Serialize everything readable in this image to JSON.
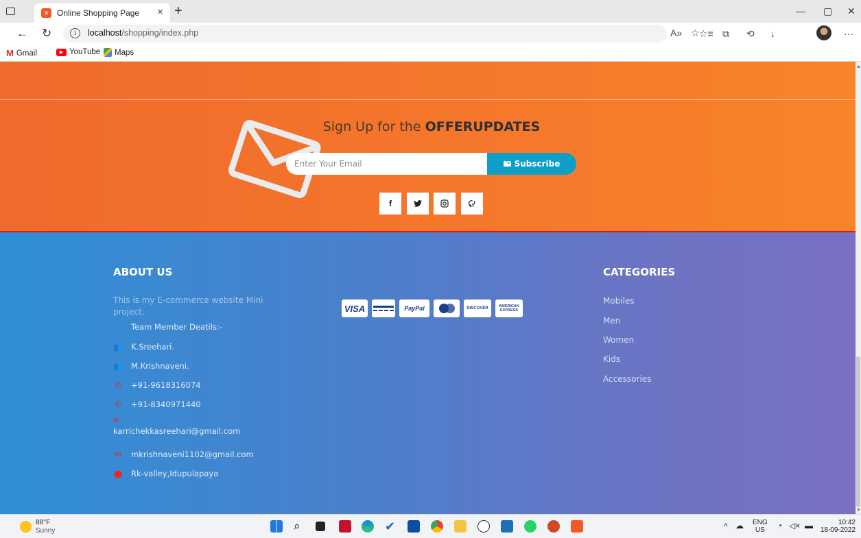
{
  "browser": {
    "tab_title": "Online Shopping Page",
    "url_host": "localhost",
    "url_path": "/shopping/index.php",
    "bookmarks": [
      {
        "label": "Gmail",
        "icon": "gmail-icon"
      },
      {
        "label": "YouTube",
        "icon": "youtube-icon"
      },
      {
        "label": "Maps",
        "icon": "maps-icon"
      }
    ]
  },
  "newsletter": {
    "title_prefix": "Sign Up for the ",
    "title_bold": "OFFERUPDATES",
    "email_placeholder": "Enter Your Email",
    "subscribe_label": "Subscribe",
    "social": [
      {
        "name": "facebook-icon",
        "glyph": "f"
      },
      {
        "name": "twitter-icon",
        "glyph": "🐦"
      },
      {
        "name": "instagram-icon",
        "glyph": "◎"
      },
      {
        "name": "github-icon",
        "glyph": "○"
      }
    ]
  },
  "footer": {
    "about": {
      "title": "ABOUT US",
      "description": "This is my E-commerce website Mini project.",
      "team_heading": "Team Member Deatils:-",
      "members": [
        "K.Sreehari.",
        "M.Krishnaveni."
      ],
      "phones": [
        "+91-9618316074",
        "+91-8340971440"
      ],
      "emails": [
        "karrichekkasreehari@gmail.com",
        "mkrishnaveni1102@gmail.com"
      ],
      "address": "Rk-valley,Idupulapaya"
    },
    "payment_cards": [
      {
        "name": "visa-card-icon",
        "label": "VISA"
      },
      {
        "name": "credit-card-icon",
        "label": ""
      },
      {
        "name": "paypal-card-icon",
        "label": "PayPal"
      },
      {
        "name": "mastercard-card-icon",
        "label": ""
      },
      {
        "name": "discover-card-icon",
        "label": "DISCOVER"
      },
      {
        "name": "amex-card-icon",
        "label": "AMERICAN EXPRESS"
      }
    ],
    "categories": {
      "title": "CATEGORIES",
      "items": [
        "Mobiles",
        "Men",
        "Women",
        "Kids",
        "Accessories"
      ]
    }
  },
  "taskbar": {
    "weather_temp": "88°F",
    "weather_cond": "Sunny",
    "lang_top": "ENG",
    "lang_bottom": "US",
    "time": "10:42",
    "date": "18-09-2022"
  },
  "colors": {
    "orange_band": "#f5782b",
    "subscribe": "#0e9ec8",
    "footer_left": "#2e8fd6",
    "footer_right": "#7a70c3",
    "accent_red": "#e5282a"
  }
}
